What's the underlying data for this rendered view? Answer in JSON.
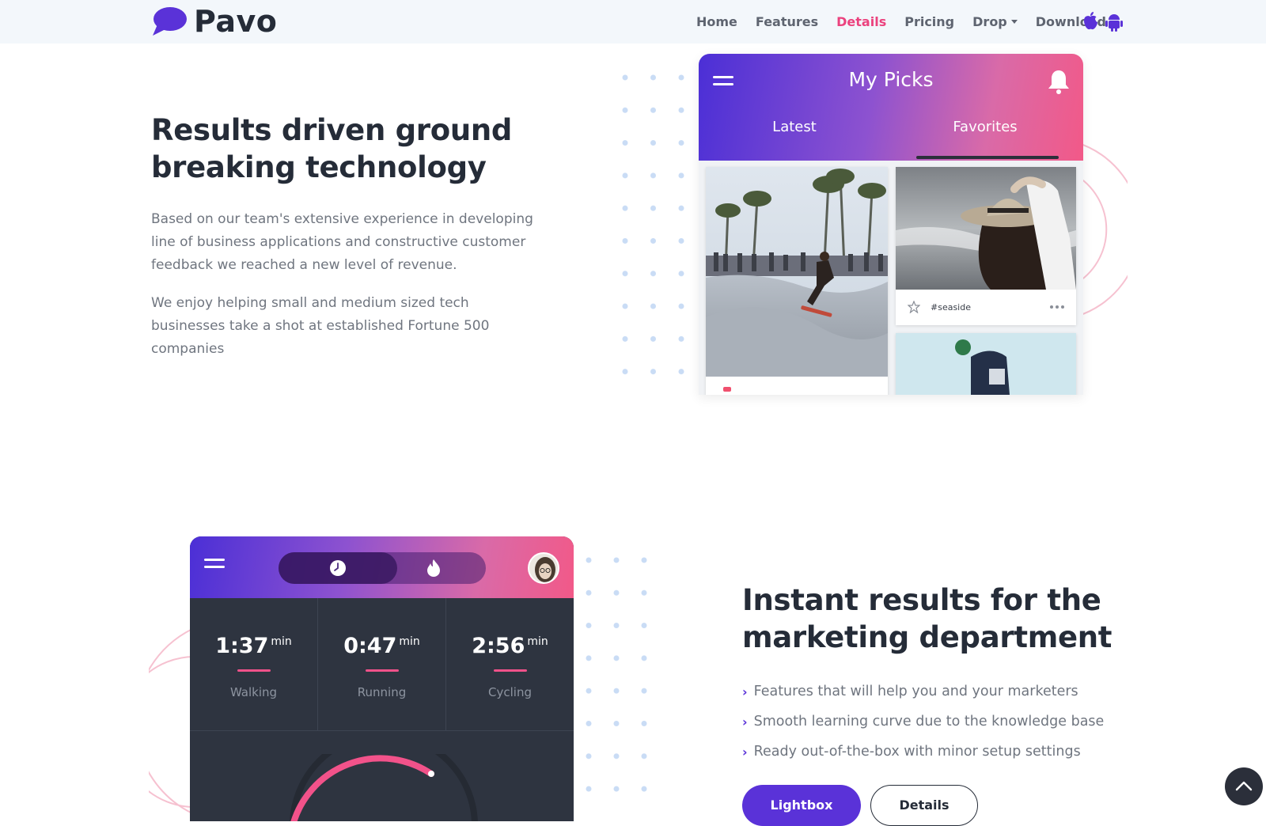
{
  "brand": {
    "name": "Pavo"
  },
  "nav": {
    "items": [
      {
        "label": "Home"
      },
      {
        "label": "Features"
      },
      {
        "label": "Details"
      },
      {
        "label": "Pricing"
      },
      {
        "label": "Drop"
      },
      {
        "label": "Download"
      }
    ],
    "active": "Details",
    "icons": [
      "apple-icon",
      "android-icon"
    ]
  },
  "section1": {
    "title_line1": "Results driven ground",
    "title_line2": "breaking technology",
    "para1_line1": "Based on our team's extensive experience in developing",
    "para1_line2": "line of business applications and constructive customer",
    "para1_line3": "feedback we reached a new level of revenue.",
    "para2_line1": "We enjoy helping small and medium sized tech",
    "para2_line2": "businesses take a shot at established Fortune 500",
    "para2_line3": "companies"
  },
  "phone1": {
    "title": "My Picks",
    "tabs": [
      "Latest",
      "Favorites"
    ],
    "active_tab": "Favorites",
    "card_tag": "#seaside"
  },
  "phone2": {
    "stats": [
      {
        "value": "1:37",
        "unit": "min",
        "label": "Walking"
      },
      {
        "value": "0:47",
        "unit": "min",
        "label": "Running"
      },
      {
        "value": "2:56",
        "unit": "min",
        "label": "Cycling"
      }
    ]
  },
  "section2": {
    "title_line1": "Instant results for the",
    "title_line2": "marketing department",
    "bullets": [
      "Features that will help you and your marketers",
      "Smooth learning curve due to the knowledge base",
      "Ready out-of-the-box with minor setup settings"
    ],
    "primary_button": "Lightbox",
    "secondary_button": "Details"
  },
  "colors": {
    "accent": "#5a32d8",
    "active_link": "#eb427e",
    "gradient_start": "#4b2fd6",
    "gradient_end": "#f25988",
    "dark": "#2e3440"
  }
}
